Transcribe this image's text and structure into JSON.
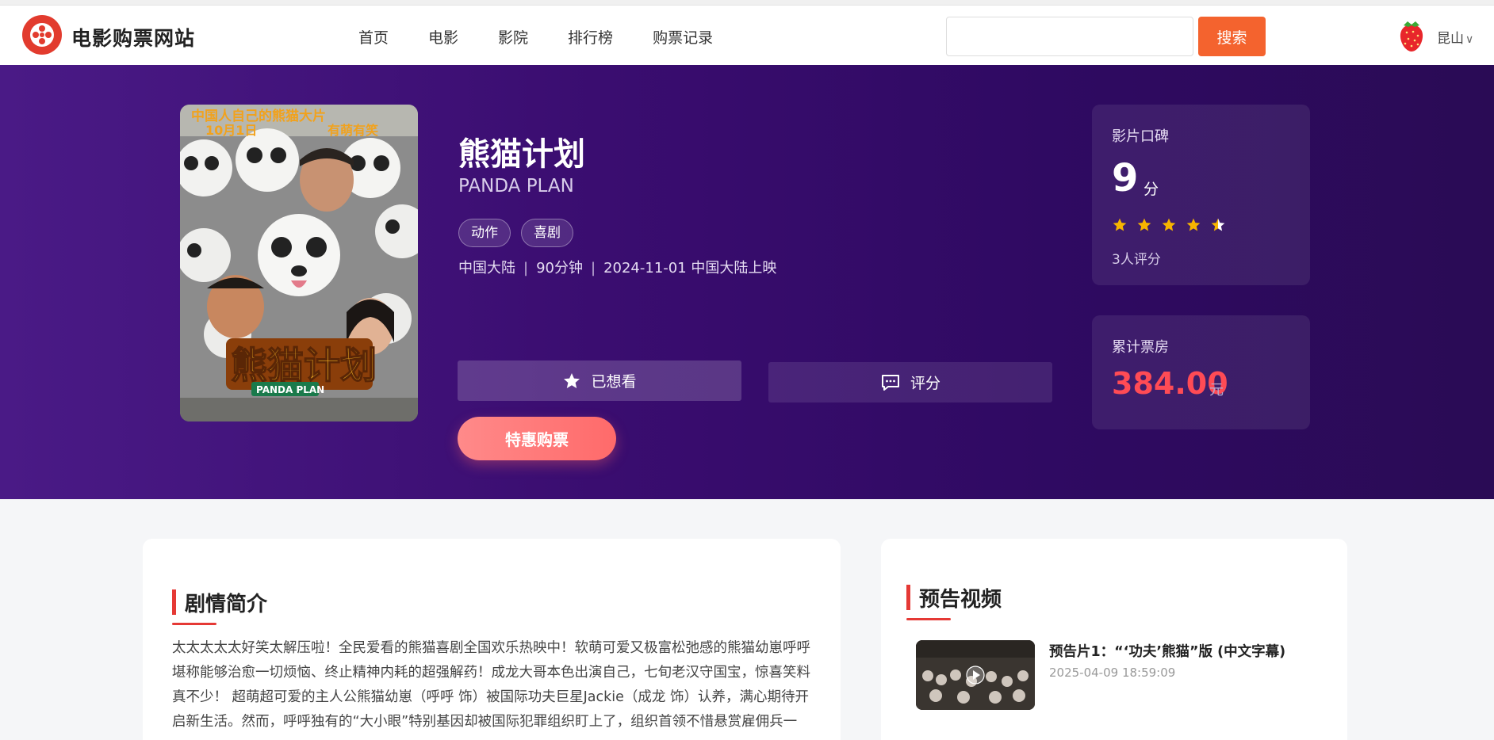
{
  "header": {
    "brand": "电影购票网站",
    "nav": [
      "首页",
      "电影",
      "影院",
      "排行榜",
      "购票记录"
    ],
    "search_placeholder": "",
    "search_button": "搜索",
    "city": "昆山"
  },
  "movie": {
    "title": "熊猫计划",
    "title_en": "PANDA PLAN",
    "tags": [
      "动作",
      "喜剧"
    ],
    "region": "中国大陆",
    "duration": "90分钟",
    "release": "2024-11-01 中国大陆上映",
    "poster_banner": "中国人自己的熊猫大片",
    "poster_date": "10月1日",
    "poster_slogan": "有萌有笑",
    "poster_title": "熊猫计划",
    "poster_en": "PANDA PLAN"
  },
  "actions": {
    "wish": "已想看",
    "rate": "评分",
    "buy": "特惠购票"
  },
  "rating": {
    "label": "影片口碑",
    "score": "9",
    "unit": "分",
    "stars_filled": 4.5,
    "count": "3人评分"
  },
  "box_office": {
    "label": "累计票房",
    "amount": "384.00",
    "unit": "元"
  },
  "synopsis": {
    "title": "剧情简介",
    "text": "太太太太太好笑太解压啦！全民爱看的熊猫喜剧全国欢乐热映中！软萌可爱又极富松弛感的熊猫幼崽呼呼堪称能够治愈一切烦恼、终止精神内耗的超强解药！成龙大哥本色出演自己，七旬老汉守国宝，惊喜笑料真不少！ 超萌超可爱的主人公熊猫幼崽（呼呼 饰）被国际功夫巨星Jackie（成龙 饰）认养，满心期待开启新生活。然而，呼呼独有的“大小眼”特别基因却被国际犯罪组织盯上了，组织首领不惜悬赏雇佣兵一"
  },
  "trailers": {
    "title": "预告视频",
    "items": [
      {
        "name": "预告片1：“‘功夫’熊猫”版 (中文字幕)",
        "time": "2025-04-09 18:59:09"
      }
    ]
  },
  "colors": {
    "accent": "#f4632e",
    "brand_red": "#e23b2e",
    "hero_bg": "#3a0d70",
    "star": "#f7b500",
    "box_office": "#ff4b55"
  }
}
